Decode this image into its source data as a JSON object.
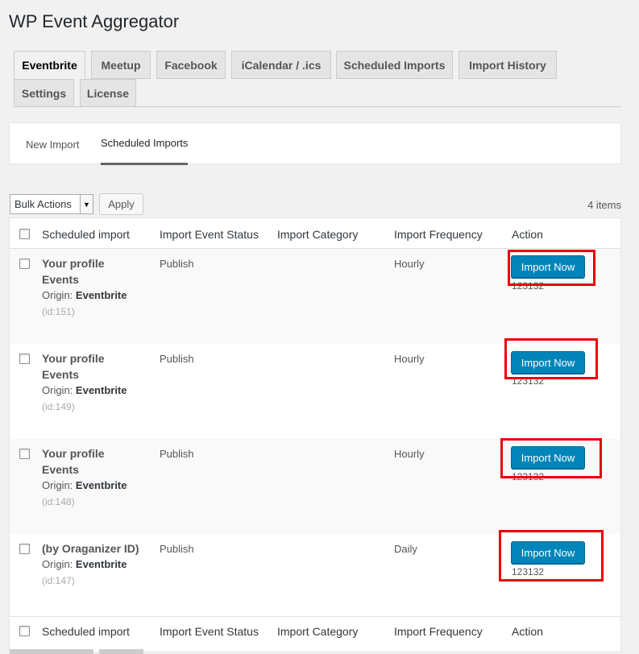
{
  "page": {
    "title": "WP Event Aggregator"
  },
  "nav_tabs": [
    {
      "label": "Eventbrite",
      "active": true
    },
    {
      "label": "Meetup"
    },
    {
      "label": "Facebook"
    },
    {
      "label": "iCalendar / .ics"
    },
    {
      "label": "Scheduled Imports"
    },
    {
      "label": "Import History"
    },
    {
      "label": "Settings"
    },
    {
      "label": "License"
    }
  ],
  "subtabs": [
    {
      "label": "New Import"
    },
    {
      "label": "Scheduled Imports",
      "active": true
    }
  ],
  "bulk": {
    "selected": "Bulk Actions",
    "apply_label": "Apply",
    "items_count": "4 items"
  },
  "table": {
    "columns": [
      "Scheduled import",
      "Import Event Status",
      "Import Category",
      "Import Frequency",
      "Action"
    ],
    "origin_label": "Origin:",
    "import_label": "Import Now",
    "rows": [
      {
        "title_line1": "Your profile",
        "title_line2": "Events",
        "origin": "Eventbrite",
        "id": "(id:151)",
        "status": "Publish",
        "frequency": "Hourly",
        "number": "123132"
      },
      {
        "title_line1": "Your profile",
        "title_line2": "Events",
        "origin": "Eventbrite",
        "id": "(id:149)",
        "status": "Publish",
        "frequency": "Hourly",
        "number": "123132"
      },
      {
        "title_line1": "Your profile",
        "title_line2": "Events",
        "origin": "Eventbrite",
        "id": "(id:148)",
        "status": "Publish",
        "frequency": "Hourly",
        "number": "123132"
      },
      {
        "title_line1": "(by Oraganizer ID)",
        "title_line2": "",
        "origin": "Eventbrite",
        "id": "(id:147)",
        "status": "Publish",
        "frequency": "Daily",
        "number": "123132"
      }
    ]
  },
  "colors": {
    "primary_button": "#0085ba",
    "highlight_box": "#e8000b"
  },
  "icons": {
    "select_caret": "▼"
  }
}
